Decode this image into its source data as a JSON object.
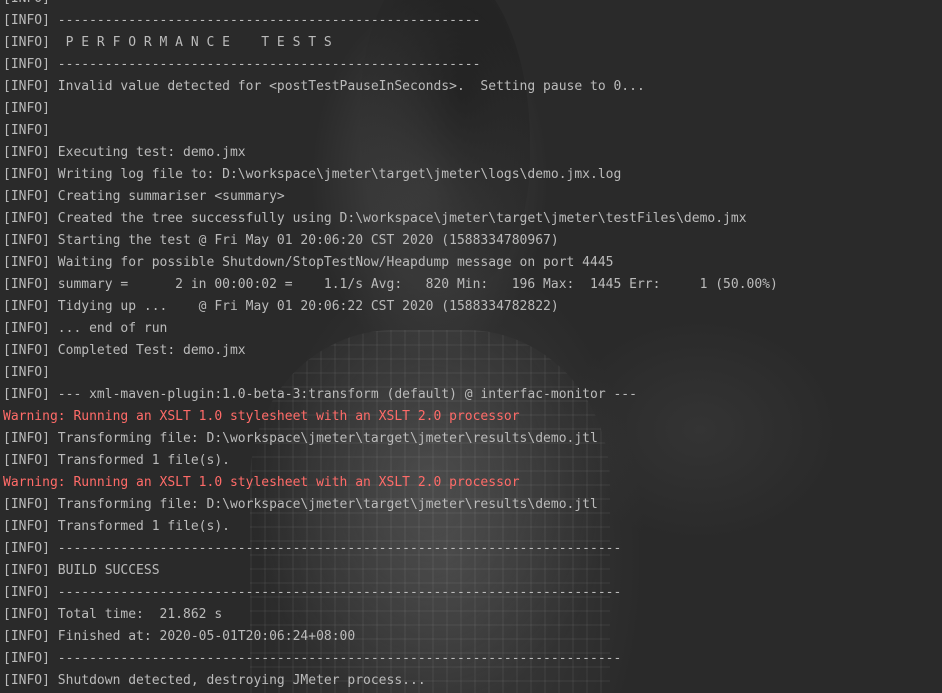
{
  "lines": [
    {
      "level": "info",
      "text": "[INFO]"
    },
    {
      "level": "info",
      "text": "[INFO] ------------------------------------------------------"
    },
    {
      "level": "info",
      "text": "[INFO]  P E R F O R M A N C E    T E S T S"
    },
    {
      "level": "info",
      "text": "[INFO] ------------------------------------------------------"
    },
    {
      "level": "info",
      "text": "[INFO] Invalid value detected for <postTestPauseInSeconds>.  Setting pause to 0..."
    },
    {
      "level": "info",
      "text": "[INFO]"
    },
    {
      "level": "info",
      "text": "[INFO]"
    },
    {
      "level": "info",
      "text": "[INFO] Executing test: demo.jmx"
    },
    {
      "level": "info",
      "text": "[INFO] Writing log file to: D:\\workspace\\jmeter\\target\\jmeter\\logs\\demo.jmx.log"
    },
    {
      "level": "info",
      "text": "[INFO] Creating summariser <summary>"
    },
    {
      "level": "info",
      "text": "[INFO] Created the tree successfully using D:\\workspace\\jmeter\\target\\jmeter\\testFiles\\demo.jmx"
    },
    {
      "level": "info",
      "text": "[INFO] Starting the test @ Fri May 01 20:06:20 CST 2020 (1588334780967)"
    },
    {
      "level": "info",
      "text": "[INFO] Waiting for possible Shutdown/StopTestNow/Heapdump message on port 4445"
    },
    {
      "level": "info",
      "text": "[INFO] summary =      2 in 00:00:02 =    1.1/s Avg:   820 Min:   196 Max:  1445 Err:     1 (50.00%)"
    },
    {
      "level": "info",
      "text": "[INFO] Tidying up ...    @ Fri May 01 20:06:22 CST 2020 (1588334782822)"
    },
    {
      "level": "info",
      "text": "[INFO] ... end of run"
    },
    {
      "level": "info",
      "text": "[INFO] Completed Test: demo.jmx"
    },
    {
      "level": "info",
      "text": "[INFO]"
    },
    {
      "level": "info",
      "text": "[INFO] --- xml-maven-plugin:1.0-beta-3:transform (default) @ interfac-monitor ---"
    },
    {
      "level": "warn",
      "text": "Warning: Running an XSLT 1.0 stylesheet with an XSLT 2.0 processor"
    },
    {
      "level": "info",
      "text": "[INFO] Transforming file: D:\\workspace\\jmeter\\target\\jmeter\\results\\demo.jtl"
    },
    {
      "level": "info",
      "text": "[INFO] Transformed 1 file(s)."
    },
    {
      "level": "warn",
      "text": "Warning: Running an XSLT 1.0 stylesheet with an XSLT 2.0 processor"
    },
    {
      "level": "info",
      "text": "[INFO] Transforming file: D:\\workspace\\jmeter\\target\\jmeter\\results\\demo.jtl"
    },
    {
      "level": "info",
      "text": "[INFO] Transformed 1 file(s)."
    },
    {
      "level": "info",
      "text": "[INFO] ------------------------------------------------------------------------"
    },
    {
      "level": "info",
      "text": "[INFO] BUILD SUCCESS"
    },
    {
      "level": "info",
      "text": "[INFO] ------------------------------------------------------------------------"
    },
    {
      "level": "info",
      "text": "[INFO] Total time:  21.862 s"
    },
    {
      "level": "info",
      "text": "[INFO] Finished at: 2020-05-01T20:06:24+08:00"
    },
    {
      "level": "info",
      "text": "[INFO] ------------------------------------------------------------------------"
    },
    {
      "level": "info",
      "text": "[INFO] Shutdown detected, destroying JMeter process..."
    }
  ],
  "colors": {
    "background": "#2b2b2b",
    "info_text": "#bbbbbb",
    "warning_text": "#ff6b68"
  }
}
